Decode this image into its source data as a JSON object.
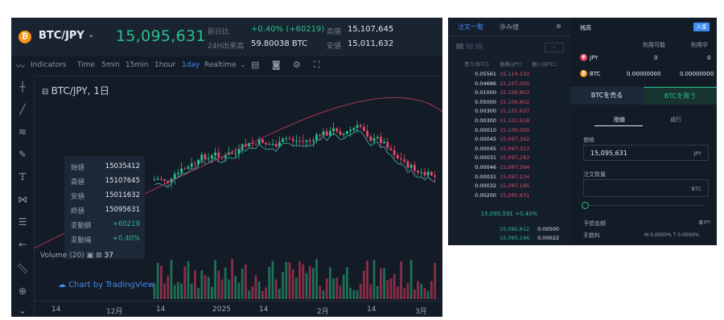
{
  "chart": {
    "pair": "BTC/JPY",
    "price": "15,095,631",
    "change_label": "前日比",
    "change_value": "+0.40% (+60219)",
    "volume_label": "24H出来高",
    "volume_value": "59.80038 BTC",
    "high_label": "高値",
    "high_value": "15,107,645",
    "low_label": "安値",
    "low_value": "15,011,632",
    "indicators_label": "Indicators",
    "intervals": [
      "Time",
      "5min",
      "15min",
      "1hour",
      "1day",
      "Realtime"
    ],
    "active_interval": "1day",
    "title": "BTC/JPY, 1日",
    "ohlc": [
      {
        "k": "始値",
        "v": "15035412"
      },
      {
        "k": "高値",
        "v": "15107645"
      },
      {
        "k": "安値",
        "v": "15011632"
      },
      {
        "k": "終値",
        "v": "15095631"
      },
      {
        "k": "変動額",
        "v": "+60219"
      },
      {
        "k": "変動幅",
        "v": "+0.40%"
      }
    ],
    "logo_text": "Chart by TradingView",
    "volume_panel_label": "Volume (20)",
    "volume_count": "37",
    "x_ticks": [
      "14",
      "12月",
      "14",
      "2025",
      "14",
      "2月",
      "14",
      "3月"
    ]
  },
  "orderbook": {
    "tab_order": "注文一覧",
    "tab_trades": "歩み値",
    "header_ask": "売り(BTC)",
    "header_price": "価格(JPY)",
    "header_bid": "買い(BTC)",
    "rows": [
      {
        "a": "0.05561",
        "p": "15,114,132"
      },
      {
        "a": "0.04686",
        "p": "15,107,000"
      },
      {
        "a": "0.01000",
        "p": "15,106,803"
      },
      {
        "a": "0.05000",
        "p": "15,106,802"
      },
      {
        "a": "0.00300",
        "p": "15,101,627"
      },
      {
        "a": "0.00300",
        "p": "15,101,618"
      },
      {
        "a": "0.00010",
        "p": "15,100,000"
      },
      {
        "a": "0.00045",
        "p": "15,097,362"
      },
      {
        "a": "0.00045",
        "p": "15,097,313"
      },
      {
        "a": "0.00031",
        "p": "15,097,283"
      },
      {
        "a": "0.00046",
        "p": "15,097,264"
      },
      {
        "a": "0.00031",
        "p": "15,097,234"
      },
      {
        "a": "0.00032",
        "p": "15,097,185"
      },
      {
        "a": "0.00200",
        "p": "15,095,631"
      }
    ],
    "mid_price": "15,095,591 +0.40%",
    "bid_rows": [
      {
        "p": "15,095,612",
        "b": "0.00500"
      },
      {
        "p": "15,095,196",
        "b": "0.00022"
      }
    ]
  },
  "account": {
    "title": "残高",
    "deposit": "入金",
    "col_available": "利用可能",
    "col_inuse": "利用中",
    "assets": [
      {
        "name": "JPY",
        "available": "0",
        "inuse": "0",
        "color": "#e5486b"
      },
      {
        "name": "BTC",
        "available": "0.00000000",
        "inuse": "0.00000000",
        "color": "#f7931a"
      }
    ],
    "sell_btn": "BTCを売る",
    "buy_btn": "BTCを買う",
    "tab_limit": "指値",
    "tab_market": "成行",
    "price_label": "価格",
    "price_value": "15,095,631",
    "price_unit": "JPY",
    "qty_label": "注文数量",
    "qty_unit": "BTC",
    "est_label": "予想金額",
    "est_value": "0",
    "est_unit": "JPY",
    "fee_label": "手数料",
    "fee_value": "M 0.0000% T 0.0000%"
  }
}
